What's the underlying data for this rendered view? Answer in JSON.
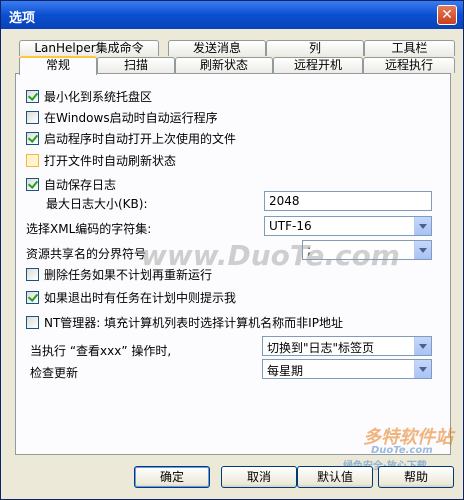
{
  "window": {
    "title": "选项",
    "close_glyph": "✕"
  },
  "tabs_back": [
    "LanHelper集成命令",
    "发送消息",
    "列",
    "工具栏"
  ],
  "tabs_front": [
    "常规",
    "扫描",
    "刷新状态",
    "远程开机",
    "远程执行"
  ],
  "options": {
    "minimize_tray": {
      "label": "最小化到系统托盘区",
      "checked": true
    },
    "startup_windows": {
      "label": "在Windows启动时自动运行程序",
      "checked": false
    },
    "open_last_file": {
      "label": "启动程序时自动打开上次使用的文件",
      "checked": true
    },
    "refresh_on_open": {
      "label": "打开文件时自动刷新状态",
      "checked": false
    },
    "autosave_log": {
      "label": "自动保存日志",
      "checked": true
    },
    "max_log_label": "最大日志大小(KB):",
    "max_log_value": "2048",
    "xml_charset_label": "选择XML编码的字符集:",
    "xml_charset_value": "UTF-16",
    "share_sep_label": "资源共享名的分界符号",
    "share_sep_value": ";",
    "delete_task": {
      "label": "删除任务如果不计划再重新运行",
      "checked": false
    },
    "exit_prompt": {
      "label": "如果退出时有任务在计划中则提示我",
      "checked": true
    },
    "nt_manager": {
      "label": "NT管理器: 填充计算机列表时选择计算机名称而非IP地址",
      "checked": false
    },
    "view_action_label": "当执行 “查看xxx” 操作时,",
    "view_action_value": "切换到\"日志\"标签页",
    "update_label": "检查更新",
    "update_value": "每星期"
  },
  "buttons": {
    "ok": "确定",
    "cancel": "取消",
    "default": "默认值",
    "help": "帮助"
  },
  "watermarks": {
    "center": "www.DuoTe.com",
    "logo": "多特软件站",
    "logo_sub": "DuoTe.com",
    "logo_tag": "绿色安全·放心下载"
  }
}
